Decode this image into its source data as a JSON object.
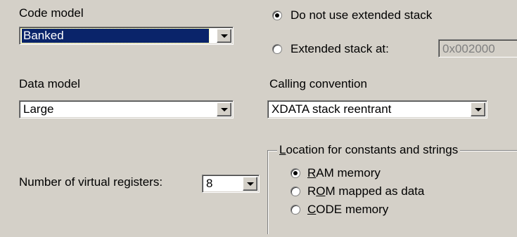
{
  "code_model": {
    "label": "Code model",
    "value": "Banked"
  },
  "data_model": {
    "label": "Data model",
    "value": "Large"
  },
  "virtual_registers": {
    "label": "Number of virtual registers:",
    "value": "8"
  },
  "stack": {
    "option_no_ext": "Do not use extended stack",
    "option_ext": "Extended stack at:",
    "address": "0x002000",
    "selected": "no_ext"
  },
  "calling_convention": {
    "label": "Calling convention",
    "value": "XDATA stack reentrant"
  },
  "constants_location": {
    "title_accel": "L",
    "title_rest": "ocation for constants and strings",
    "options": [
      {
        "accel": "R",
        "rest": "AM memory",
        "pre": ""
      },
      {
        "accel": "O",
        "rest": "M mapped as data",
        "pre": "R"
      },
      {
        "accel": "C",
        "rest": "ODE memory",
        "pre": ""
      }
    ],
    "selected_index": 0
  }
}
